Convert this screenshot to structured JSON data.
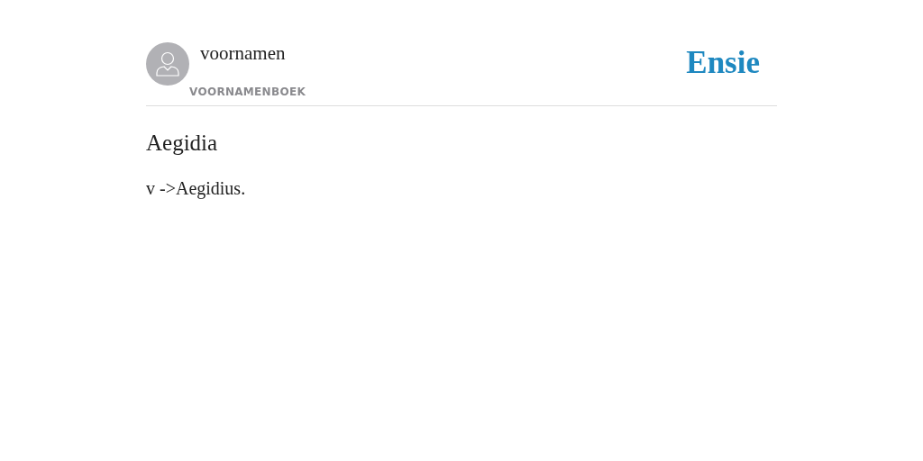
{
  "author": {
    "name": "voornamen",
    "source": "VOORNAMENBOEK"
  },
  "logo": "Ensie",
  "entry": {
    "title": "Aegidia",
    "body": "v ->Aegidius."
  }
}
